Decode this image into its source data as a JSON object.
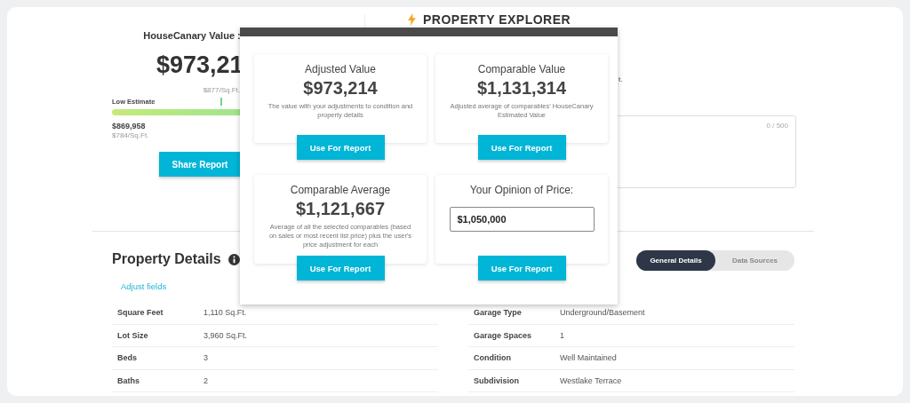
{
  "valuation": {
    "title": "HouseCanary Value :",
    "value": "$973,21",
    "per_sqft": "$877/Sq.Ft.",
    "low_label": "Low Estimate",
    "level": 0.45,
    "low_value": "$869,958",
    "low_per_sqft": "$784/Sq.Ft.",
    "button": "Share Report"
  },
  "explorer": {
    "title": "PROPERTY EXPLORER",
    "text_fragment": "t.",
    "notes_counter": "0 / 500"
  },
  "modal": {
    "cards": [
      {
        "kind": "value",
        "title": "Adjusted Value",
        "value": "$973,214",
        "description": "The value with your adjustments to condition and property details",
        "button": "Use For Report"
      },
      {
        "kind": "value",
        "title": "Comparable Value",
        "value": "$1,131,314",
        "description": "Adjusted average of comparables' HouseCanary Estimated Value",
        "button": "Use For Report"
      },
      {
        "kind": "value",
        "title": "Comparable Average",
        "value": "$1,121,667",
        "description": "Average of all the selected comparables (based on sales or most recent list price) plus the user's price adjustment for each",
        "button": "Use For Report"
      },
      {
        "kind": "input",
        "title": "Your Opinion of Price:",
        "value": "$1,050,000",
        "button": "Use For Report"
      }
    ]
  },
  "details": {
    "title": "Property Details",
    "adjust_link": "Adjust fields",
    "tabs": [
      {
        "label": "General Details",
        "selected": true
      },
      {
        "label": "Data Sources",
        "selected": false
      }
    ],
    "left_rows": [
      {
        "label": "Square Feet",
        "value": "1,110 Sq.Ft."
      },
      {
        "label": "Lot Size",
        "value": "3,960 Sq.Ft."
      },
      {
        "label": "Beds",
        "value": "3"
      },
      {
        "label": "Baths",
        "value": "2"
      }
    ],
    "right_rows": [
      {
        "label": "Garage Type",
        "value": "Underground/Basement"
      },
      {
        "label": "Garage Spaces",
        "value": "1"
      },
      {
        "label": "Condition",
        "value": "Well Maintained"
      },
      {
        "label": "Subdivision",
        "value": "Westlake Terrace"
      }
    ]
  }
}
